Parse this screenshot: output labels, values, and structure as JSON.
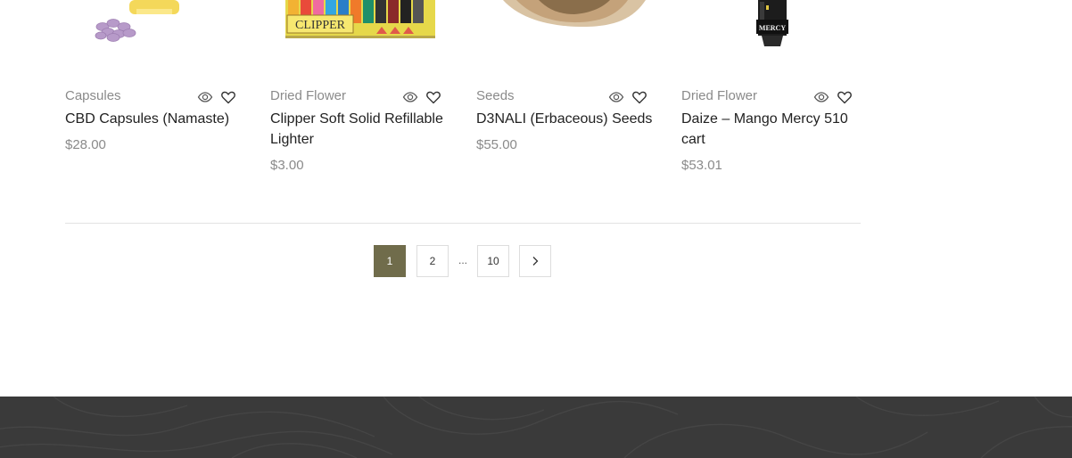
{
  "products": [
    {
      "category": "Capsules",
      "title": "CBD Capsules (Namaste)",
      "price": "$28.00",
      "image_icon": "capsules-bottle-image"
    },
    {
      "category": "Dried Flower",
      "title": "Clipper Soft Solid Refillable Lighter",
      "price": "$3.00",
      "image_icon": "lighter-box-image",
      "image_text": "CLIPPER"
    },
    {
      "category": "Seeds",
      "title": "D3NALI (Erbaceous) Seeds",
      "price": "$55.00",
      "image_icon": "seeds-jar-image"
    },
    {
      "category": "Dried Flower",
      "title": "Daize – Mango Mercy 510 cart",
      "price": "$53.01",
      "image_icon": "cartridge-image",
      "image_text": "MERCY"
    }
  ],
  "pagination": {
    "current": "1",
    "page2": "2",
    "ellipsis": "...",
    "last": "10",
    "next_icon": "chevron-right-icon"
  },
  "colors": {
    "accent": "#706c4b",
    "footer_bg": "#3a3a3a",
    "muted_text": "#8a8a8a",
    "title_text": "#222222"
  }
}
